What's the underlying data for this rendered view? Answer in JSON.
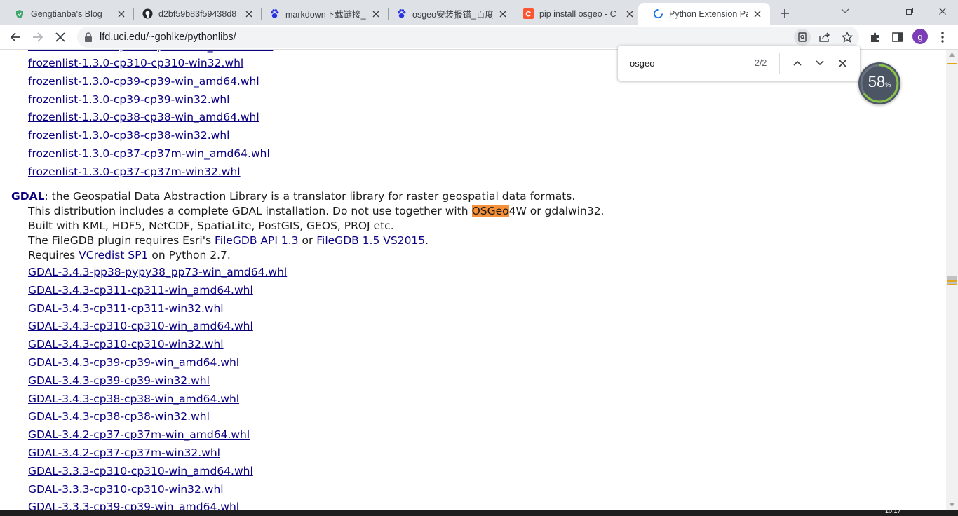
{
  "tabs": [
    {
      "title": "Gengtianba's Blog",
      "icon": "shield-icon"
    },
    {
      "title": "d2bf59b83f59438d8",
      "icon": "github-icon"
    },
    {
      "title": "markdown下载链接_",
      "icon": "baidu-paw-icon"
    },
    {
      "title": "osgeo安装报错_百度",
      "icon": "baidu-paw-icon"
    },
    {
      "title": "pip install osgeo - C",
      "icon": "csdn-icon"
    },
    {
      "title": "Python Extension Pa",
      "icon": "loading-spinner-icon"
    }
  ],
  "address_bar": {
    "url": "lfd.uci.edu/~gohlke/pythonlibs/"
  },
  "profile": {
    "initial": "g",
    "color": "#7b3db6"
  },
  "find_bar": {
    "query": "osgeo",
    "count": "2/2"
  },
  "widget": {
    "value": "58",
    "unit": "%"
  },
  "frozenlist_links": [
    "frozenlist-1.3.0-cp310-cp310-win32.whl",
    "frozenlist-1.3.0-cp39-cp39-win_amd64.whl",
    "frozenlist-1.3.0-cp39-cp39-win32.whl",
    "frozenlist-1.3.0-cp38-cp38-win_amd64.whl",
    "frozenlist-1.3.0-cp38-cp38-win32.whl",
    "frozenlist-1.3.0-cp37-cp37m-win_amd64.whl",
    "frozenlist-1.3.0-cp37-cp37m-win32.whl"
  ],
  "gdal": {
    "name": "GDAL",
    "desc": ": the Geospatial Data Abstraction Library is a translator library for raster geospatial data formats.",
    "line1_pre": "This distribution includes a complete GDAL installation. Do not use together with ",
    "line1_hl": "OSGeo",
    "line1_post": "4W or gdalwin32.",
    "line2": "Built with KML, HDF5, NetCDF, SpatiaLite, PostGIS, GEOS, PROJ etc.",
    "line3_pre": "The FileGDB plugin requires Esri's ",
    "line3_link1": "FileGDB API 1.3",
    "line3_mid": " or ",
    "line3_link2": "FileGDB 1.5 VS2015",
    "line3_post": ".",
    "line4_pre": "Requires ",
    "line4_link": "VCredist SP1",
    "line4_post": " on Python 2.7.",
    "links": [
      "GDAL-3.4.3-pp38-pypy38_pp73-win_amd64.whl",
      "GDAL-3.4.3-cp311-cp311-win_amd64.whl",
      "GDAL-3.4.3-cp311-cp311-win32.whl",
      "GDAL-3.4.3-cp310-cp310-win_amd64.whl",
      "GDAL-3.4.3-cp310-cp310-win32.whl",
      "GDAL-3.4.3-cp39-cp39-win_amd64.whl",
      "GDAL-3.4.3-cp39-cp39-win32.whl",
      "GDAL-3.4.3-cp38-cp38-win_amd64.whl",
      "GDAL-3.4.3-cp38-cp38-win32.whl",
      "GDAL-3.4.2-cp37-cp37m-win_amd64.whl",
      "GDAL-3.4.2-cp37-cp37m-win32.whl",
      "GDAL-3.3.3-cp310-cp310-win_amd64.whl",
      "GDAL-3.3.3-cp310-cp310-win32.whl",
      "GDAL-3.3.3-cp39-cp39-win_amd64.whl"
    ]
  },
  "taskbar": {
    "clock": "10:17"
  }
}
